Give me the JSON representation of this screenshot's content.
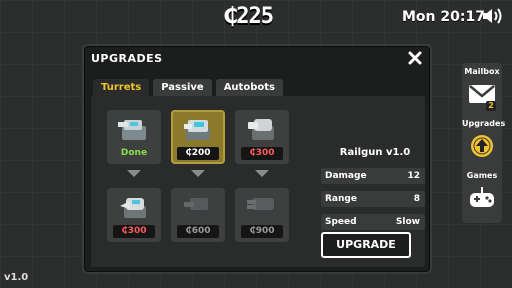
{
  "hud": {
    "currency": "₵225",
    "clock": "Mon 20:17",
    "version": "v1.0"
  },
  "panel": {
    "title": "UPGRADES",
    "tabs": [
      "Turrets",
      "Passive",
      "Autobots"
    ],
    "active_tab": "Turrets"
  },
  "slots": [
    {
      "label": "Done",
      "state": "done"
    },
    {
      "label": "₵200",
      "state": "selected"
    },
    {
      "label": "₵300",
      "state": "red"
    },
    {
      "label": "₵300",
      "state": "red"
    },
    {
      "label": "₵600",
      "state": "grey"
    },
    {
      "label": "₵900",
      "state": "grey"
    }
  ],
  "info": {
    "title": "Railgun v1.0",
    "stats": [
      {
        "key": "Damage",
        "value": "12"
      },
      {
        "key": "Range",
        "value": "8"
      },
      {
        "key": "Speed",
        "value": "Slow"
      }
    ],
    "upgrade_label": "UPGRADE"
  },
  "side": {
    "mailbox_label": "Mailbox",
    "mailbox_badge": "2",
    "upgrades_label": "Upgrades",
    "games_label": "Games"
  },
  "colors": {
    "accent": "#f2c230",
    "done": "#8be04a",
    "price_red": "#ff5b5b"
  }
}
